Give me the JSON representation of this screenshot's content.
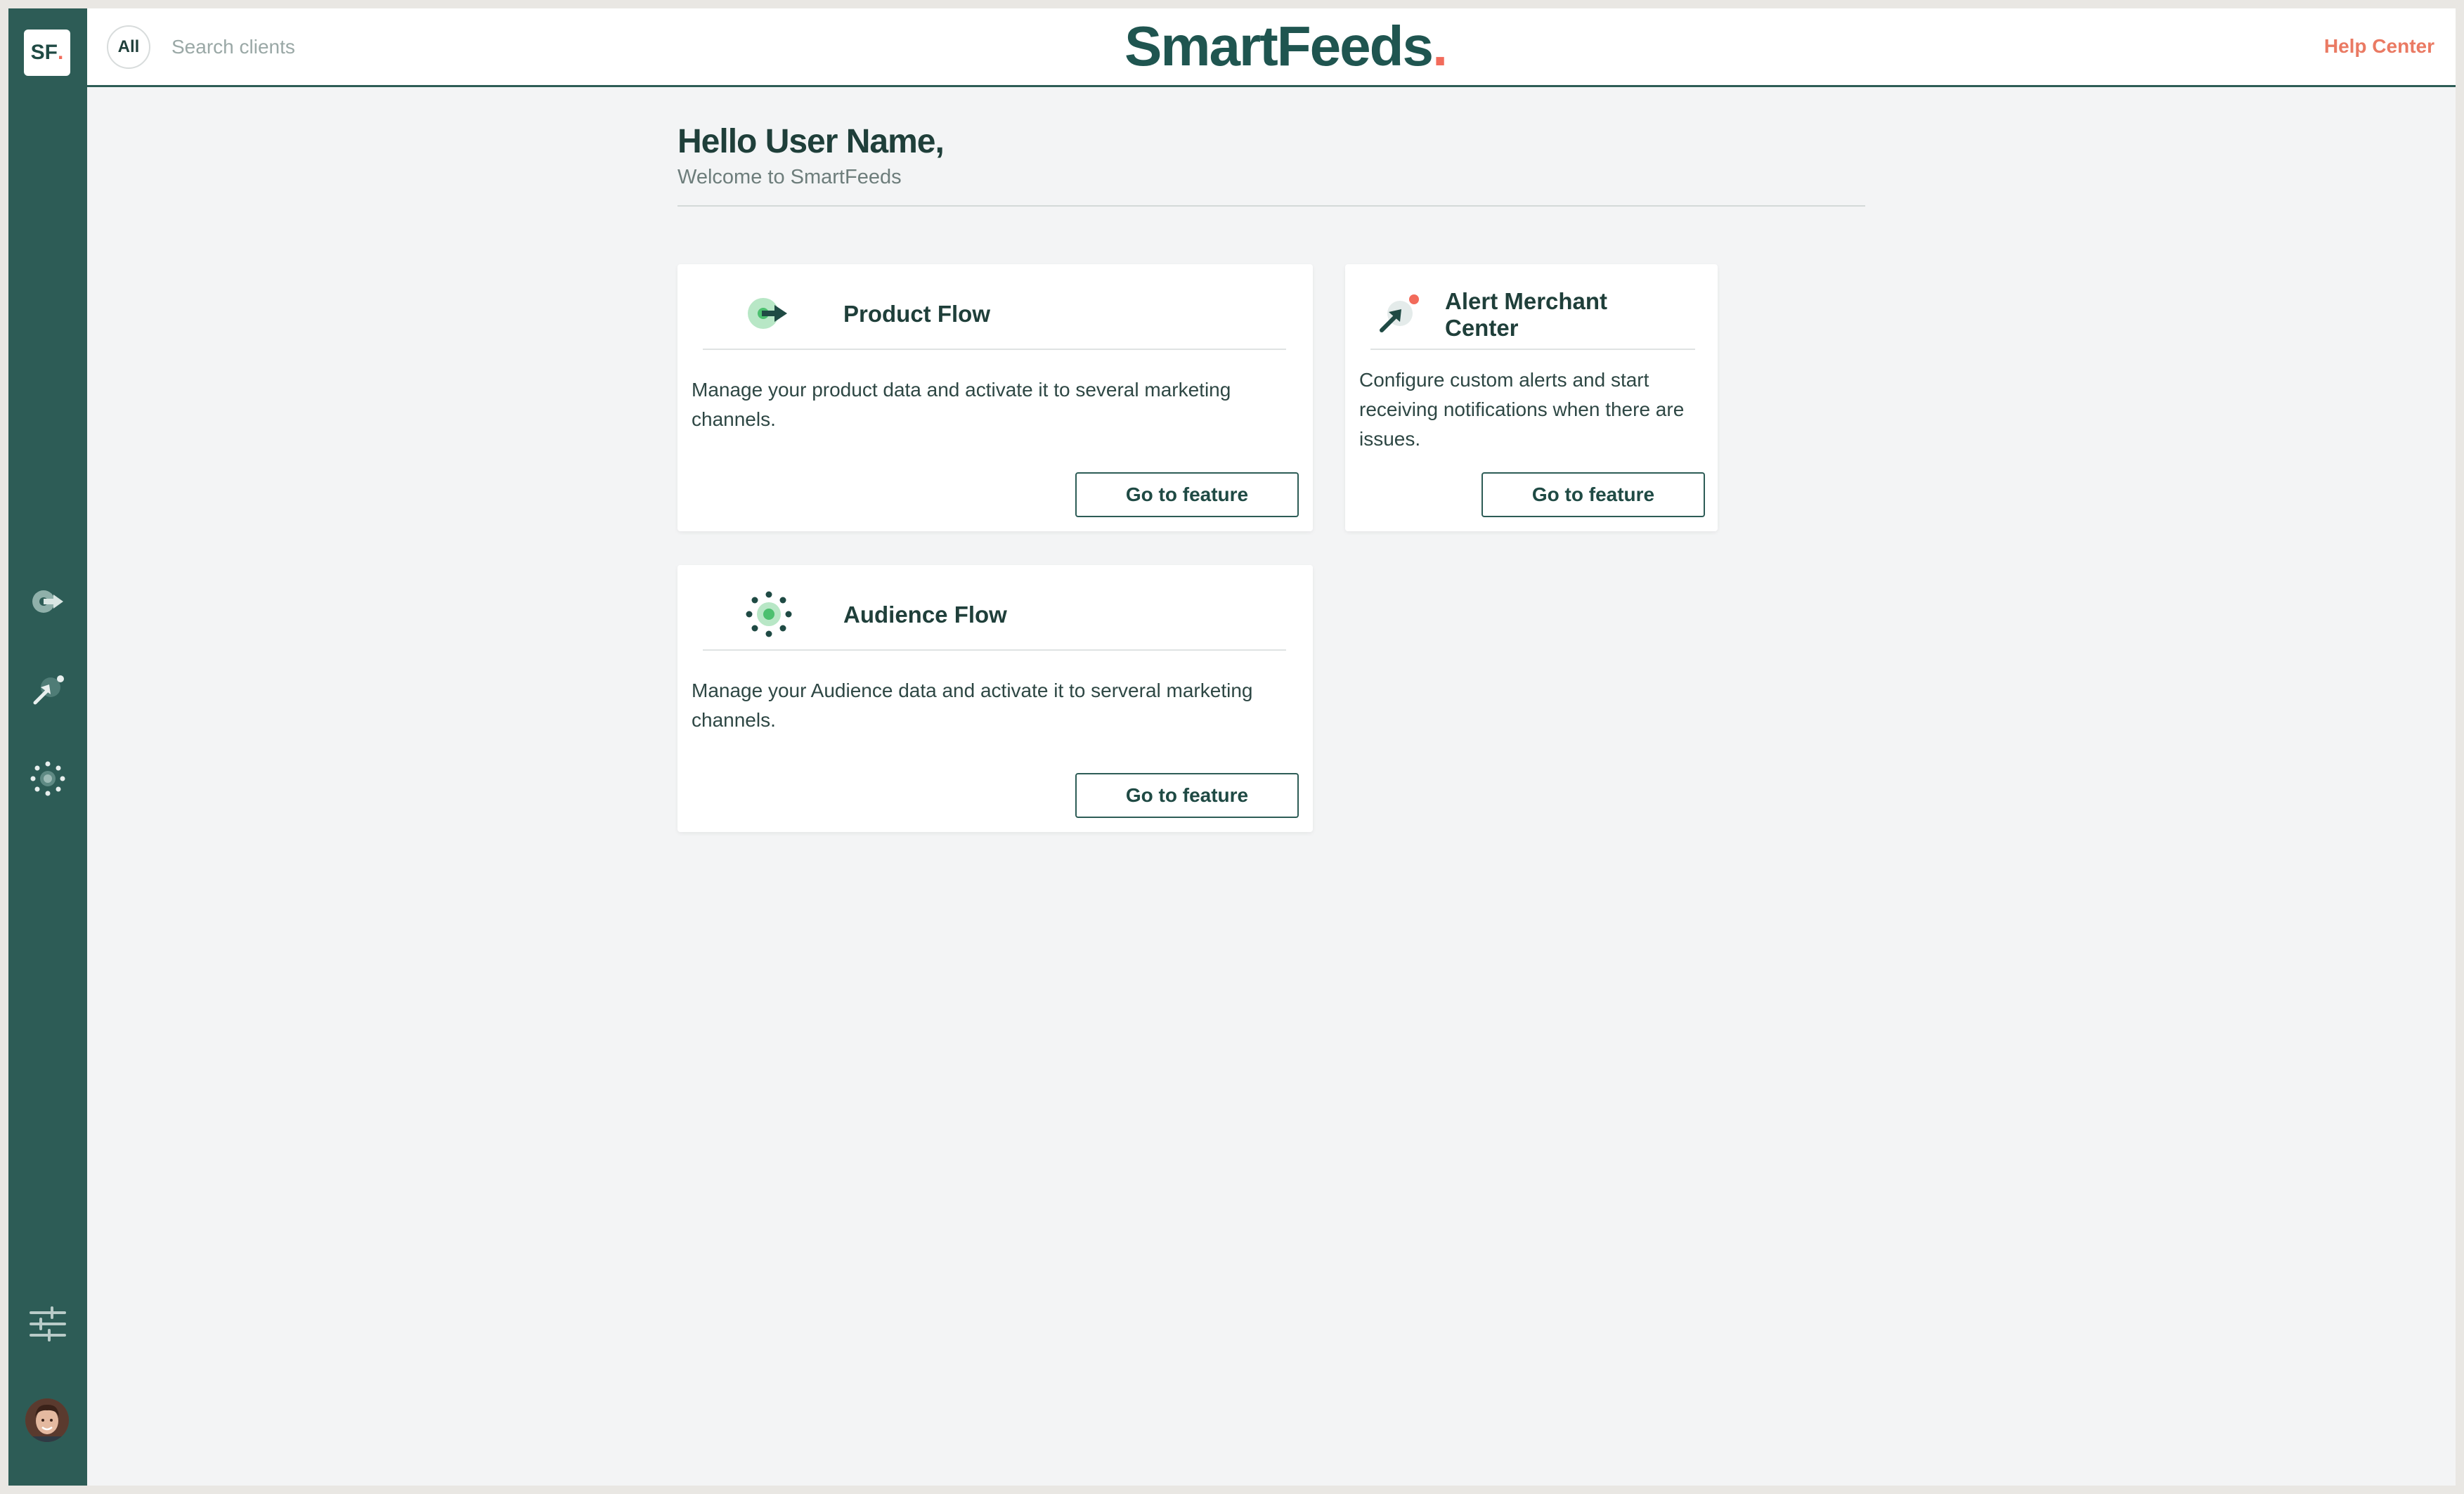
{
  "sidebar": {
    "logo_text": "SF",
    "logo_dot": ".",
    "icons": [
      "product-flow-icon",
      "alert-merchant-icon",
      "audience-flow-icon",
      "settings-sliders-icon"
    ],
    "avatar": "user-avatar"
  },
  "header": {
    "all_label": "All",
    "search_placeholder": "Search clients",
    "brand": "SmartFeeds",
    "brand_dot": ".",
    "help_label": "Help Center"
  },
  "main": {
    "greeting": "Hello User Name,",
    "welcome": "Welcome to SmartFeeds",
    "cards": [
      {
        "title": "Product Flow",
        "description": "Manage your product data and activate it to several marketing channels.",
        "button": "Go to feature"
      },
      {
        "title": "Alert Merchant Center",
        "description": "Configure custom alerts and start receiving notifications when there are issues.",
        "button": "Go to feature"
      },
      {
        "title": "Audience Flow",
        "description": "Manage your Audience data and activate it to serveral marketing channels.",
        "button": "Go to feature"
      }
    ]
  },
  "colors": {
    "sidebar": "#2d5c56",
    "brand": "#1f5550",
    "accent": "#f26b5b",
    "help_link": "#ea7a63",
    "background": "#f3f4f5"
  }
}
